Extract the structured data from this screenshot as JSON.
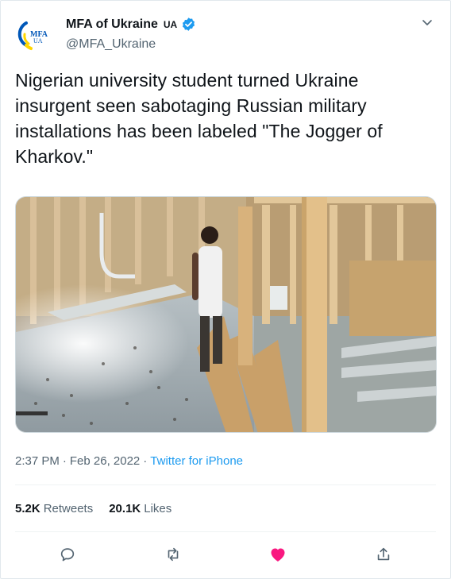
{
  "account": {
    "display_name": "MFA of Ukraine",
    "country_code": "UA",
    "handle": "@MFA_Ukraine",
    "avatar_text_top": "MFA",
    "avatar_text_bottom": "UA",
    "verified_icon": "verified-badge-icon"
  },
  "tweet": {
    "text": "Nigerian university student turned Ukraine insurgent seen sabotaging Russian military installations has been labeled \"The Jogger of Kharkov.\""
  },
  "meta": {
    "time": "2:37 PM",
    "separator": "·",
    "date": "Feb 26, 2022",
    "separator2": "·",
    "source": "Twitter for iPhone"
  },
  "stats": {
    "retweets_count": "5.2K",
    "retweets_label": "Retweets",
    "likes_count": "20.1K",
    "likes_label": "Likes"
  },
  "actions": {
    "reply_icon": "reply-icon",
    "retweet_icon": "retweet-icon",
    "like_icon": "heart-filled-icon",
    "share_icon": "share-icon"
  },
  "colors": {
    "accent": "#1d9bf0",
    "like": "#f91880",
    "muted": "#536471",
    "text": "#0f1419",
    "logo_blue": "#0057b8",
    "logo_yellow": "#ffd700"
  }
}
